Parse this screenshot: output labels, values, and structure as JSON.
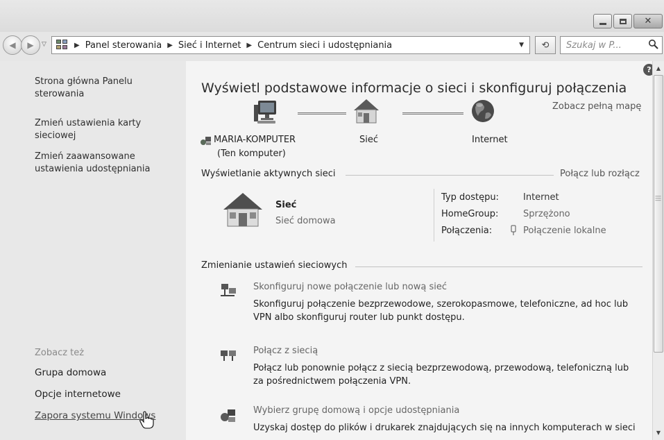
{
  "window": {
    "caption_buttons": {
      "minimize": "minimize",
      "maximize": "maximize",
      "close": "close"
    }
  },
  "nav": {
    "breadcrumbs": [
      "Panel sterowania",
      "Sieć i Internet",
      "Centrum sieci i udostępniania"
    ],
    "search_placeholder": "Szukaj w P..."
  },
  "sidebar": {
    "links": [
      {
        "label_line1": "Strona główna Panelu",
        "label_line2": "sterowania"
      },
      {
        "label_line1": "Zmień ustawienia karty",
        "label_line2": "sieciowej"
      },
      {
        "label_line1": "Zmień zaawansowane",
        "label_line2": "ustawienia udostępniania"
      }
    ],
    "see_also_label": "Zobacz też",
    "see_also": [
      "Grupa domowa",
      "Opcje internetowe",
      "Zapora systemu Windows"
    ]
  },
  "main": {
    "title": "Wyświetl podstawowe informacje o sieci i skonfiguruj połączenia",
    "see_full_map": "Zobacz pełną mapę",
    "map": {
      "computer_line1": "MARIA-KOMPUTER",
      "computer_line2": "(Ten komputer)",
      "network": "Sieć",
      "internet": "Internet"
    },
    "active": {
      "header": "Wyświetlanie aktywnych sieci",
      "connect_link": "Połącz lub rozłącz",
      "name": "Sieć",
      "type": "Sieć domowa",
      "props": [
        {
          "key": "Typ dostępu:",
          "value": "Internet"
        },
        {
          "key": "HomeGroup:",
          "value": "Sprzężono"
        },
        {
          "key": "Połączenia:",
          "value": "Połączenie lokalne"
        }
      ]
    },
    "change": {
      "header": "Zmienianie ustawień sieciowych",
      "tasks": [
        {
          "title": "Skonfiguruj nowe połączenie lub nową sieć",
          "desc_line1": "Skonfiguruj połączenie bezprzewodowe, szerokopasmowe, telefoniczne, ad hoc lub",
          "desc_line2": "VPN albo skonfiguruj router lub punkt dostępu."
        },
        {
          "title": "Połącz z siecią",
          "desc_line1": "Połącz lub ponownie połącz z siecią bezprzewodową, przewodową, telefoniczną lub",
          "desc_line2": "za pośrednictwem połączenia VPN."
        },
        {
          "title": "Wybierz grupę domową i opcje udostępniania",
          "desc_line1": "Uzyskaj dostęp do plików i drukarek znajdujących się na innych komputerach w sieci",
          "desc_line2": ""
        }
      ]
    }
  }
}
